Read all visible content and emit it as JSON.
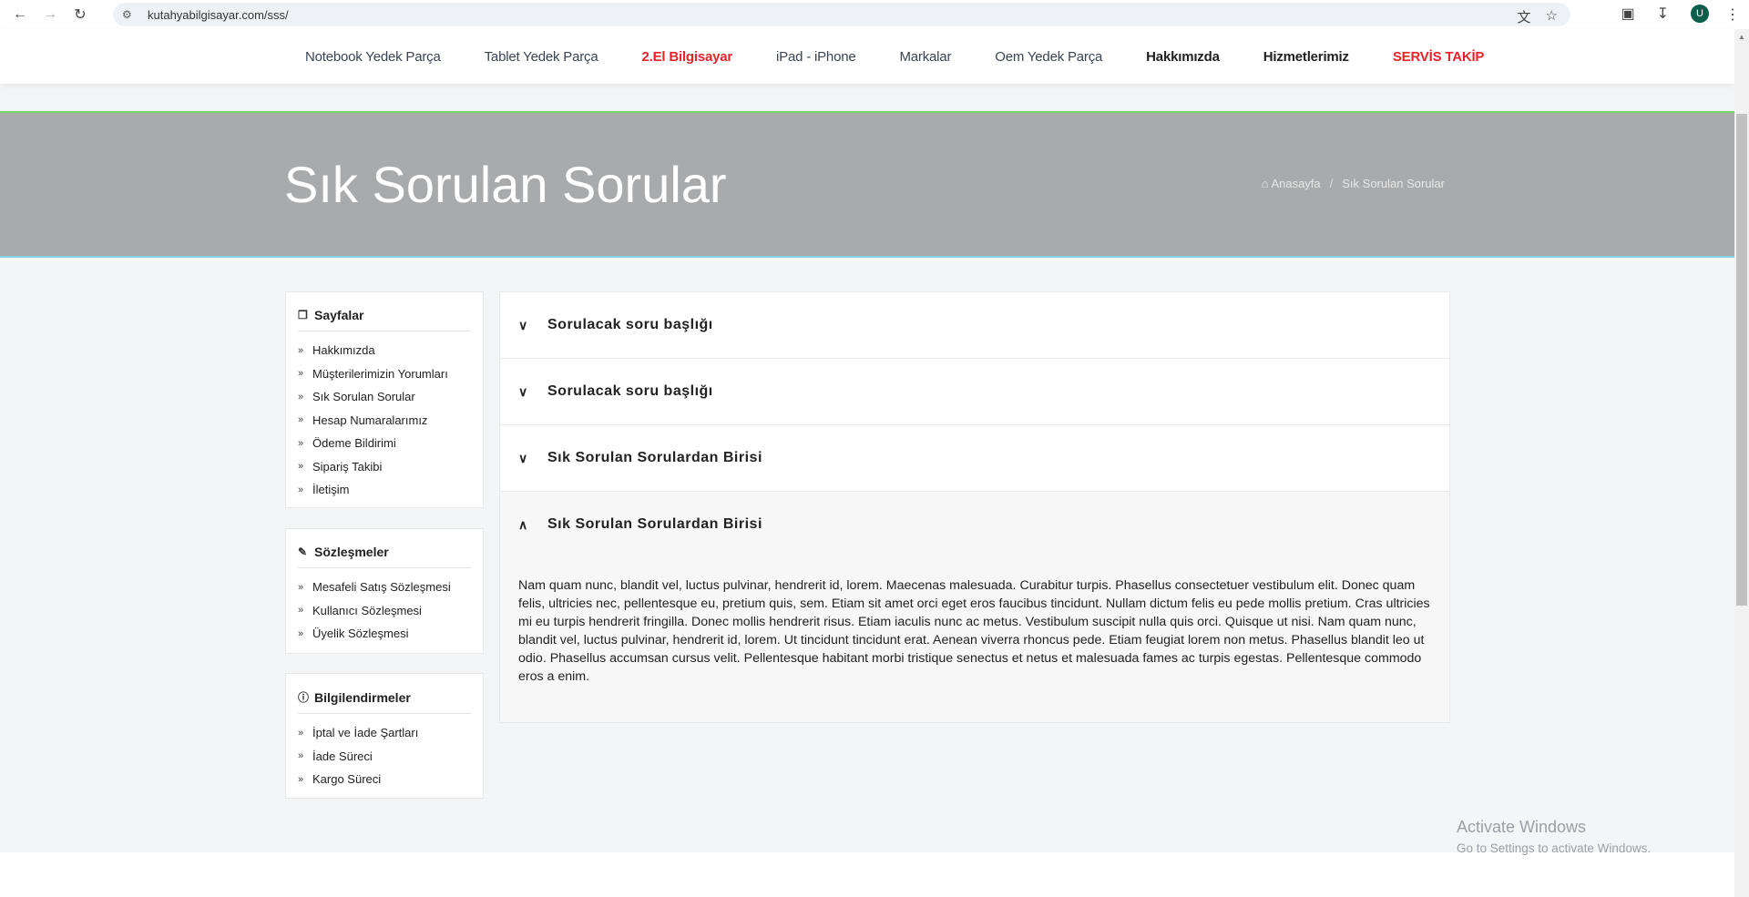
{
  "browser": {
    "url": "kutahyabilgisayar.com/sss/",
    "profile_initial": "U"
  },
  "nav": {
    "items": [
      {
        "label": "Notebook Yedek Parça",
        "style": "normal"
      },
      {
        "label": "Tablet Yedek Parça",
        "style": "normal"
      },
      {
        "label": "2.El Bilgisayar",
        "style": "red"
      },
      {
        "label": "iPad - iPhone",
        "style": "normal"
      },
      {
        "label": "Markalar",
        "style": "normal"
      },
      {
        "label": "Oem Yedek Parça",
        "style": "normal"
      },
      {
        "label": "Hakkımızda",
        "style": "bold"
      },
      {
        "label": "Hizmetlerimiz",
        "style": "bold"
      },
      {
        "label": "SERVİS TAKİP",
        "style": "red"
      }
    ]
  },
  "header": {
    "title": "Sık Sorulan Sorular",
    "breadcrumb_home": "Anasayfa",
    "breadcrumb_sep": "/",
    "breadcrumb_current": "Sık Sorulan Sorular"
  },
  "sidebar": {
    "pages": {
      "title": "Sayfalar",
      "items": [
        "Hakkımızda",
        "Müşterilerimizin Yorumları",
        "Sık Sorulan Sorular",
        "Hesap Numaralarımız",
        "Ödeme Bildirimi",
        "Sipariş Takibi",
        "İletişim"
      ]
    },
    "contracts": {
      "title": "Sözleşmeler",
      "items": [
        "Mesafeli Satış Sözleşmesi",
        "Kullanıcı Sözleşmesi",
        "Üyelik Sözleşmesi"
      ]
    },
    "info": {
      "title": "Bilgilendirmeler",
      "items": [
        "İptal ve İade Şartları",
        "İade Süreci",
        "Kargo Süreci"
      ]
    }
  },
  "faq": {
    "items": [
      {
        "question": "Sorulacak soru başlığı",
        "open": false
      },
      {
        "question": "Sorulacak soru başlığı",
        "open": false
      },
      {
        "question": "Sık Sorulan Sorulardan Birisi",
        "open": false
      },
      {
        "question": "Sık Sorulan Sorulardan Birisi",
        "open": true
      }
    ],
    "answer": "Nam quam nunc, blandit vel, luctus pulvinar, hendrerit id, lorem. Maecenas malesuada. Curabitur turpis. Phasellus consectetuer vestibulum elit. Donec quam felis, ultricies nec, pellentesque eu, pretium quis, sem. Etiam sit amet orci eget eros faucibus tincidunt. Nullam dictum felis eu pede mollis pretium. Cras ultricies mi eu turpis hendrerit fringilla. Donec mollis hendrerit risus. Etiam iaculis nunc ac metus. Vestibulum suscipit nulla quis orci. Quisque ut nisi. Nam quam nunc, blandit vel, luctus pulvinar, hendrerit id, lorem. Ut tincidunt tincidunt erat. Aenean viverra rhoncus pede. Etiam feugiat lorem non metus. Phasellus blandit leo ut odio. Phasellus accumsan cursus velit. Pellentesque habitant morbi tristique senectus et netus et malesuada fames ac turpis egestas. Pellentesque commodo eros a enim."
  },
  "watermark": {
    "title": "Activate Windows",
    "subtitle": "Go to Settings to activate Windows."
  }
}
